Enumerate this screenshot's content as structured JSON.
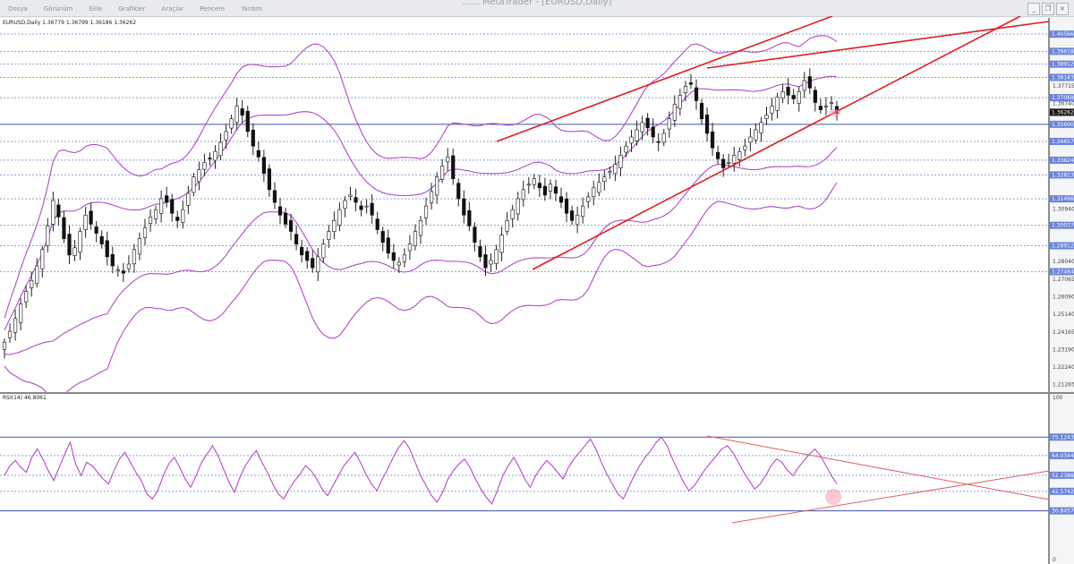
{
  "window": {
    "title": "...... MetaTrader - [EURUSD,Daily]",
    "menu": [
      "Dosya",
      "Görünüm",
      "Ekle",
      "Grafikler",
      "Araçlar",
      "Pencere",
      "Yardım"
    ]
  },
  "chart_data": [
    {
      "type": "candlestick",
      "title": "EURUSD,Daily  1.36779 1.36799 1.36186 1.36262",
      "symbol": "EURUSD",
      "timeframe": "Daily",
      "ohlc_last": {
        "open": 1.36779,
        "high": 1.36799,
        "low": 1.36186,
        "close": 1.36262
      },
      "current_price": 1.36262,
      "ylim": [
        1.2085,
        1.4146
      ],
      "price_ticks": [
        "1.40566",
        "1.39618",
        "1.38912",
        "1.38183",
        "1.37715",
        "1.37068",
        "1.36740",
        "1.36262",
        "1.35600",
        "1.34657",
        "1.33624",
        "1.32813",
        "1.31496",
        "1.30940",
        "1.30037",
        "1.28912",
        "1.28040",
        "1.27484",
        "1.27065",
        "1.26090",
        "1.25140",
        "1.24165",
        "1.23190",
        "1.22240",
        "1.21265"
      ],
      "horizontal_levels": [
        1.40566,
        1.39618,
        1.38912,
        1.38183,
        1.37068,
        1.34657,
        1.33624,
        1.32813,
        1.31496,
        1.30037,
        1.28912,
        1.27484
      ],
      "highlighted_level": 1.356,
      "indicators": [
        "Bollinger Bands (outer)",
        "Bollinger Bands (inner)"
      ],
      "close_series": [
        1.236,
        1.242,
        1.249,
        1.257,
        1.264,
        1.27,
        1.278,
        1.287,
        1.3,
        1.314,
        1.305,
        1.293,
        1.284,
        1.288,
        1.297,
        1.306,
        1.301,
        1.296,
        1.29,
        1.283,
        1.278,
        1.276,
        1.274,
        1.279,
        1.287,
        1.293,
        1.299,
        1.305,
        1.309,
        1.315,
        1.313,
        1.307,
        1.303,
        1.309,
        1.318,
        1.327,
        1.331,
        1.335,
        1.337,
        1.341,
        1.346,
        1.352,
        1.359,
        1.366,
        1.361,
        1.352,
        1.344,
        1.338,
        1.329,
        1.32,
        1.313,
        1.306,
        1.301,
        1.297,
        1.29,
        1.284,
        1.281,
        1.277,
        1.283,
        1.29,
        1.297,
        1.303,
        1.309,
        1.314,
        1.317,
        1.313,
        1.309,
        1.311,
        1.306,
        1.298,
        1.291,
        1.285,
        1.281,
        1.28,
        1.284,
        1.29,
        1.297,
        1.303,
        1.311,
        1.319,
        1.327,
        1.333,
        1.338,
        1.326,
        1.315,
        1.306,
        1.3,
        1.291,
        1.283,
        1.277,
        1.281,
        1.287,
        1.295,
        1.303,
        1.309,
        1.315,
        1.32,
        1.323,
        1.326,
        1.321,
        1.317,
        1.323,
        1.318,
        1.313,
        1.307,
        1.303,
        1.306,
        1.311,
        1.316,
        1.321,
        1.324,
        1.327,
        1.33,
        1.334,
        1.339,
        1.344,
        1.349,
        1.353,
        1.357,
        1.354,
        1.349,
        1.346,
        1.351,
        1.359,
        1.367,
        1.372,
        1.377,
        1.378,
        1.369,
        1.359,
        1.351,
        1.343,
        1.337,
        1.332,
        1.335,
        1.339,
        1.341,
        1.344,
        1.349,
        1.353,
        1.357,
        1.361,
        1.366,
        1.371,
        1.374,
        1.372,
        1.37,
        1.374,
        1.38,
        1.376,
        1.368,
        1.364,
        1.366,
        1.368,
        1.362
      ],
      "trendlines": [
        "channel upper",
        "channel lower",
        "resistance line"
      ]
    },
    {
      "type": "line",
      "title": "RSI(14) 46.8061",
      "indicator": "RSI(14)",
      "current_value": 46.8061,
      "ylim": [
        0,
        100
      ],
      "top_label": "100",
      "bottom_label": "0",
      "levels": [
        75.1243,
        64.0344,
        52.2388,
        42.5742,
        30.8457
      ],
      "values": [
        52,
        58,
        61,
        57,
        54,
        63,
        68,
        62,
        55,
        49,
        57,
        65,
        72,
        59,
        52,
        60,
        58,
        54,
        50,
        47,
        55,
        62,
        66,
        60,
        54,
        49,
        41,
        38,
        43,
        52,
        59,
        63,
        57,
        50,
        45,
        52,
        60,
        65,
        70,
        64,
        56,
        48,
        42,
        51,
        58,
        63,
        67,
        60,
        54,
        47,
        41,
        38,
        44,
        49,
        53,
        58,
        55,
        50,
        44,
        40,
        46,
        52,
        58,
        62,
        66,
        60,
        53,
        47,
        43,
        50,
        56,
        63,
        69,
        73,
        68,
        60,
        52,
        46,
        40,
        36,
        42,
        50,
        55,
        59,
        62,
        57,
        50,
        44,
        39,
        35,
        43,
        52,
        58,
        63,
        57,
        50,
        45,
        52,
        57,
        61,
        58,
        54,
        50,
        57,
        62,
        66,
        70,
        74,
        68,
        60,
        53,
        47,
        41,
        38,
        45,
        52,
        58,
        63,
        67,
        72,
        75,
        70,
        62,
        55,
        48,
        43,
        46,
        51,
        56,
        60,
        64,
        68,
        70,
        66,
        60,
        54,
        49,
        44,
        47,
        52,
        58,
        62,
        60,
        55,
        52,
        57,
        61,
        65,
        68,
        64,
        58,
        52,
        47
      ]
    }
  ]
}
